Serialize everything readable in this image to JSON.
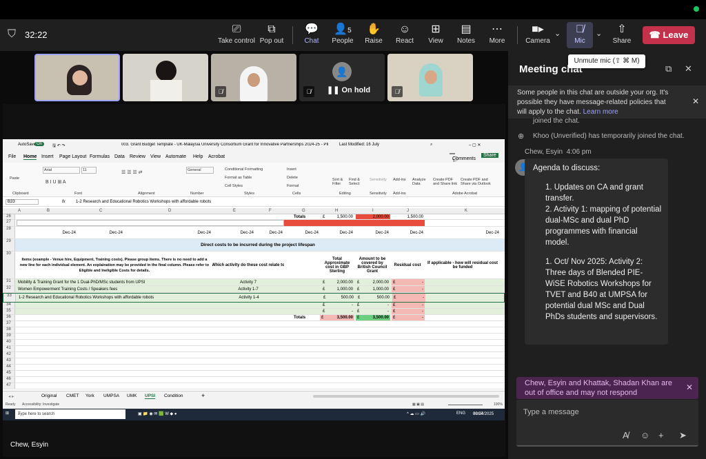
{
  "meeting": {
    "timer": "32:22"
  },
  "toolbar": {
    "take_control": "Take control",
    "pop_out": "Pop out",
    "chat": "Chat",
    "people": "People",
    "people_count": "5",
    "raise": "Raise",
    "react": "React",
    "view": "View",
    "notes": "Notes",
    "more": "More",
    "camera": "Camera",
    "mic": "Mic",
    "share": "Share",
    "leave": "Leave"
  },
  "tooltip": "Unmute mic (⇧ ⌘ M)",
  "participants": [
    {
      "status": "On hold"
    }
  ],
  "presenter": "Chew, Esyin",
  "chat": {
    "title": "Meeting chat",
    "banner_text": "Some people in this chat are outside your org. It's possible they have message-related policies that will apply to the chat.",
    "banner_link": "Learn more",
    "system_1": "joined the chat.",
    "system_2": "Khoo (Unverified) has temporarily joined the chat.",
    "message": {
      "sender": "Chew, Esyin",
      "time": "4:06 pm",
      "intro": "Agenda to discuss:",
      "items": [
        "1. Updates on CA and grant transfer.",
        "2. Activity 1: mapping of potential dual-MSc and dual PhD programmes with financial model.",
        "1. Oct/ Nov 2025: Activity 2: Three days of Blended PIE-WiSE Robotics Workshops for TVET and B40 at UMPSA for potential dual MSc and Dual PhDs students and supervisors."
      ]
    },
    "ooo_notice": "Chew, Esyin and Khattak, Shadan Khan are out of office and may not respond",
    "composer_placeholder": "Type a message"
  },
  "excel": {
    "autosave": "AutoSave",
    "autosave_state": "On",
    "filename": "003. Grant Budget Template - UK-Malaysia University Consortium Grant for Innovative Partnerships 2024-25 - PIE WiSE.xlsx",
    "modified": "Last Modified: 16 July",
    "menu": [
      "File",
      "Home",
      "Insert",
      "Page Layout",
      "Formulas",
      "Data",
      "Review",
      "View",
      "Automate",
      "Help",
      "Acrobat"
    ],
    "comments": "Comments",
    "share": "Share",
    "ribbon": {
      "paste": "Paste",
      "clipboard": "Clipboard",
      "font_name": "Arial",
      "font_size": "11",
      "font": "Font",
      "alignment": "Alignment",
      "number_format": "General",
      "number": "Number",
      "cond_format": "Conditional Formatting",
      "format_table": "Format as Table",
      "cell_styles": "Cell Styles",
      "styles": "Styles",
      "insert": "Insert",
      "delete": "Delete",
      "format": "Format",
      "cells": "Cells",
      "sort": "Sort & Filter",
      "find": "Find & Select",
      "editing": "Editing",
      "sensitivity": "Sensitivity",
      "addins": "Add-ins",
      "analyze": "Analyze Data",
      "pdf1": "Create PDF and Share link",
      "pdf2": "Create PDF and Share via Outlook",
      "adobe": "Adobe Acrobat"
    },
    "name_box": "B33",
    "formula": "1-2 Research and Educational Robotics Workshops with affordable robots",
    "columns": [
      "A",
      "B",
      "C",
      "D",
      "E",
      "F",
      "G",
      "H",
      "I",
      "J",
      "K"
    ],
    "rows": {
      "r26_totals": "Totals",
      "r26_h": "1,500.00",
      "r26_i": "2,000.00",
      "r26_j": "1,500.00",
      "dec": "Dec-24",
      "r29": "Direct costs to be incurred during the project lifespan",
      "r30_b": "Items (example - Venue hire, Equipment, Training costs). Please group items. There is no need to add a new line for each individual element. An explaination may be provided in the final column. Please refer to Eligible and Ineligible Costs for details.",
      "r30_e": "Which activity do these cost relate to",
      "r30_h": "Total Approximate cost in GBP Sterling",
      "r30_i": "Amount to be covered by British Council Grant",
      "r30_j": "Residual cost",
      "r30_k": "If applicable - how will residual cost be funded",
      "r31_b": "Mobility & Training Grant for the 1 Dual-PhD/MSc students from UPSI",
      "r31_e": "Activity 7",
      "r31_h": "2,000.00",
      "r31_i": "2,000.00",
      "r32_b": "Women Empowerment Training Costs / Speakers fees",
      "r32_e": "Activity 1-7",
      "r32_h": "1,000.00",
      "r32_i": "1,000.00",
      "r33_b": "1-2 Research and Educational Robotics Workshops with affordable robots",
      "r33_e": "Activity 1-4",
      "r33_h": "500.00",
      "r33_i": "500.00",
      "pound": "£",
      "dash": "-",
      "r36_totals": "Totals",
      "r36_h": "3,500.00",
      "r36_i": "3,500.00"
    },
    "sheets": [
      "Original",
      "CMET",
      "York",
      "UMPSA",
      "UMK",
      "UPSI",
      "Condition"
    ],
    "active_sheet": "UPSI",
    "status_ready": "Ready",
    "status_access": "Accessibility: Investigate",
    "zoom": "100%",
    "search_placeholder": "Type here to search",
    "clock_time": "09:24",
    "clock_date": "30/07/2025",
    "lang": "ENG"
  }
}
